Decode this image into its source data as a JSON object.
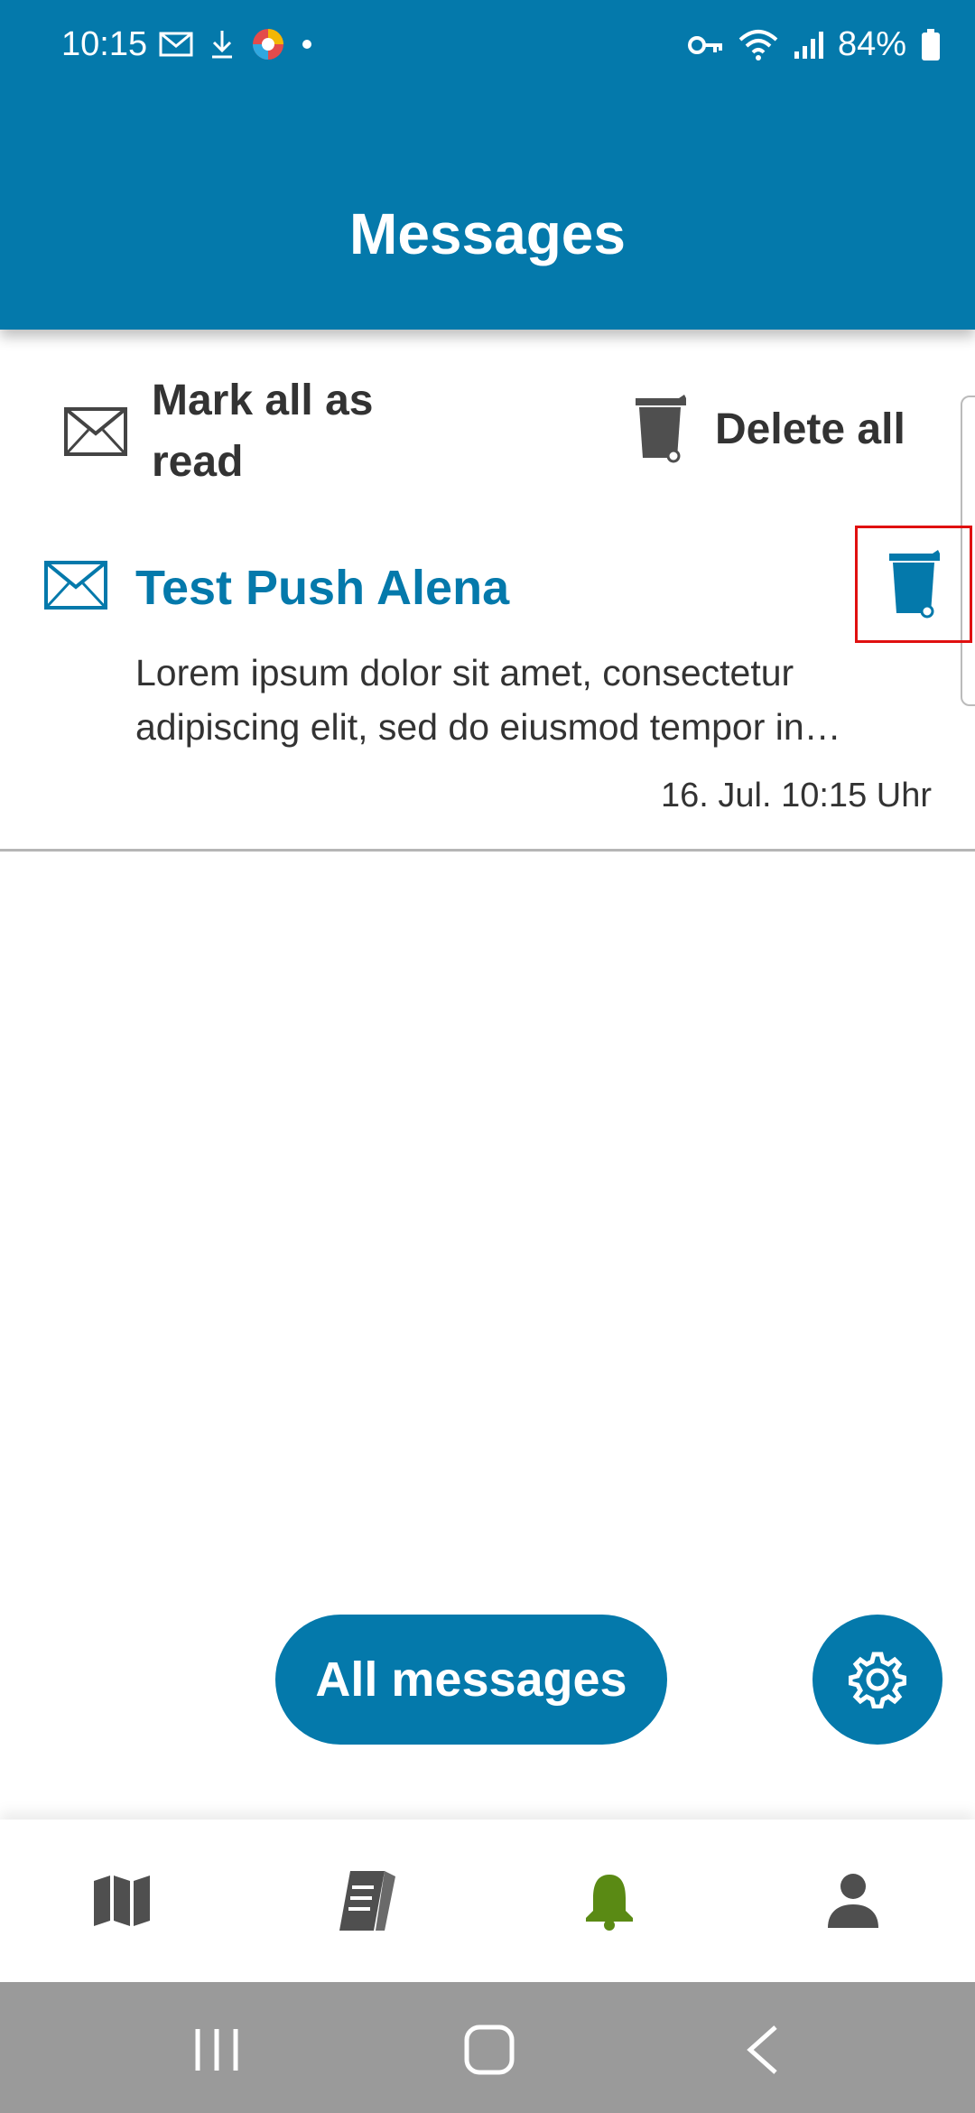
{
  "status_bar": {
    "time": "10:15",
    "battery": "84%"
  },
  "header": {
    "title": "Messages"
  },
  "actions": {
    "mark_all_read": "Mark all as read",
    "delete_all": "Delete all"
  },
  "messages": [
    {
      "subject": "Test Push Alena",
      "preview": "Lorem ipsum dolor sit amet, consectetur adipiscing elit, sed do eiusmod tempor in…",
      "date": "16. Jul. 10:15 Uhr"
    }
  ],
  "buttons": {
    "all_messages": "All messages"
  },
  "colors": {
    "brand_blue": "#0479ab",
    "active_nav_green": "#5a8a14",
    "icon_gray": "#4f4f4f",
    "highlight_red": "#e01010"
  },
  "bottom_nav": [
    {
      "icon": "map-icon",
      "active": false
    },
    {
      "icon": "tickets-icon",
      "active": false
    },
    {
      "icon": "bell-icon",
      "active": true
    },
    {
      "icon": "person-icon",
      "active": false
    }
  ]
}
